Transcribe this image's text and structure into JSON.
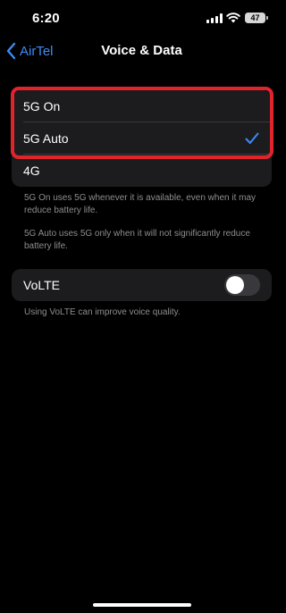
{
  "status_bar": {
    "time": "6:20",
    "battery": "47"
  },
  "nav": {
    "back_label": "AirTel",
    "title": "Voice & Data"
  },
  "modes": {
    "items": [
      {
        "label": "5G On",
        "selected": false
      },
      {
        "label": "5G Auto",
        "selected": true
      },
      {
        "label": "4G",
        "selected": false
      }
    ],
    "footnote_1": "5G On uses 5G whenever it is available, even when it may reduce battery life.",
    "footnote_2": "5G Auto uses 5G only when it will not significantly reduce battery life."
  },
  "volte": {
    "label": "VoLTE",
    "enabled": false,
    "footnote": "Using VoLTE can improve voice quality."
  },
  "colors": {
    "accent": "#3c8bf7",
    "highlight": "#e0242c",
    "cell": "#1c1c1e"
  }
}
